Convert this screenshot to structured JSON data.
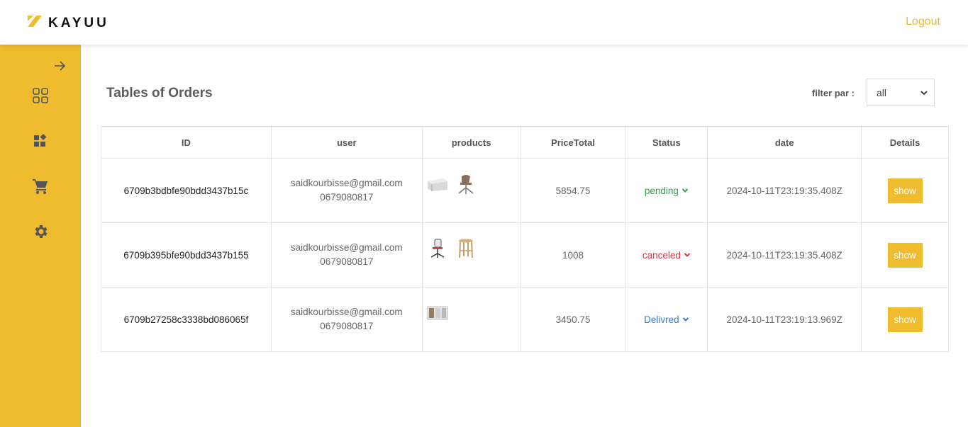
{
  "header": {
    "brand": "KAYUU",
    "logout_label": "Logout"
  },
  "sidebar": {
    "items": [
      {
        "icon": "arrow-right-icon"
      },
      {
        "icon": "grid-icon"
      },
      {
        "icon": "widgets-icon"
      },
      {
        "icon": "cart-icon"
      },
      {
        "icon": "gear-icon"
      }
    ]
  },
  "main": {
    "title": "Tables of Orders",
    "filter": {
      "label": "filter par :",
      "selected": "all"
    }
  },
  "table": {
    "headers": [
      "ID",
      "user",
      "products",
      "PriceTotal",
      "Status",
      "date",
      "Details"
    ],
    "rows": [
      {
        "id": "6709b3bdbfe90bdd3437b15c",
        "email": "saidkourbisse@gmail.com",
        "phone": "0679080817",
        "products": [
          "sideboard-image",
          "chair-image"
        ],
        "price": "5854.75",
        "status": "pending",
        "status_color": "#28a745",
        "date": "2024-10-11T23:19:35.408Z",
        "details": "show"
      },
      {
        "id": "6709b395bfe90bdd3437b155",
        "email": "saidkourbisse@gmail.com",
        "phone": "0679080817",
        "products": [
          "office-chair-image",
          "stool-image"
        ],
        "price": "1008",
        "status": "canceled",
        "status_color": "#dc3545",
        "date": "2024-10-11T23:19:35.408Z",
        "details": "show"
      },
      {
        "id": "6709b27258c3338bd086065f",
        "email": "saidkourbisse@gmail.com",
        "phone": "0679080817",
        "products": [
          "cabinet-image"
        ],
        "price": "3450.75",
        "status": "Delivred",
        "status_color": "#2f7be0",
        "date": "2024-10-11T23:19:13.969Z",
        "details": "show"
      }
    ]
  },
  "colors": {
    "accent": "#efbc2f",
    "logout": "#f0b92d"
  }
}
